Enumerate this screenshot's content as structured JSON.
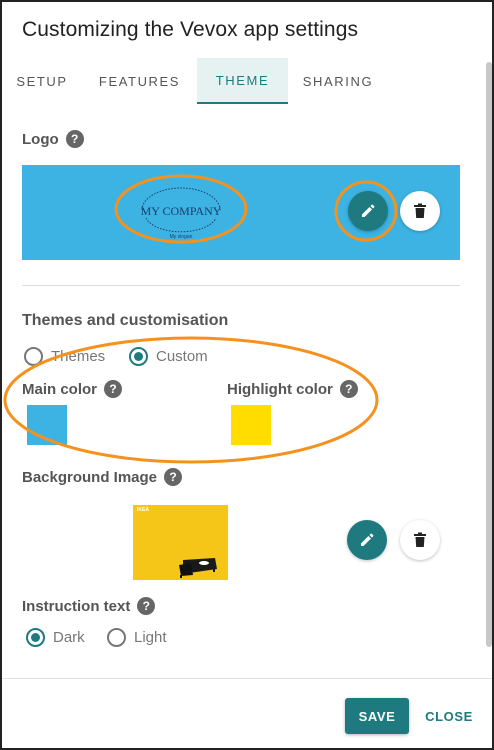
{
  "dialog": {
    "title": "Customizing the Vevox app settings"
  },
  "tabs": [
    {
      "label": "SETUP",
      "active": false
    },
    {
      "label": "FEATURES",
      "active": false
    },
    {
      "label": "THEME",
      "active": true
    },
    {
      "label": "SHARING",
      "active": false
    }
  ],
  "logo": {
    "label": "Logo",
    "help_icon": "question-circle-icon",
    "box_color": "#3cb3e3",
    "company_text": "MY COMPANY",
    "slogan_text": "My slogan"
  },
  "themes": {
    "label": "Themes and customisation",
    "options": [
      {
        "label": "Themes",
        "checked": false
      },
      {
        "label": "Custom",
        "checked": true
      }
    ],
    "main_color_label": "Main color",
    "main_color": "#3cb3e3",
    "highlight_color_label": "Highlight color",
    "highlight_color": "#ffdd00"
  },
  "background": {
    "label": "Background Image",
    "thumb_color": "#f5c518",
    "thumb_text": "IKEA"
  },
  "instruction": {
    "label": "Instruction text",
    "options": [
      {
        "label": "Dark",
        "checked": true
      },
      {
        "label": "Light",
        "checked": false
      }
    ]
  },
  "footer": {
    "save_label": "SAVE",
    "close_label": "CLOSE"
  },
  "colors": {
    "accent": "#1f7a80",
    "annotation": "#f5921e"
  },
  "icons": {
    "edit": "pencil-icon",
    "delete": "trash-icon",
    "help": "question-circle-icon"
  }
}
